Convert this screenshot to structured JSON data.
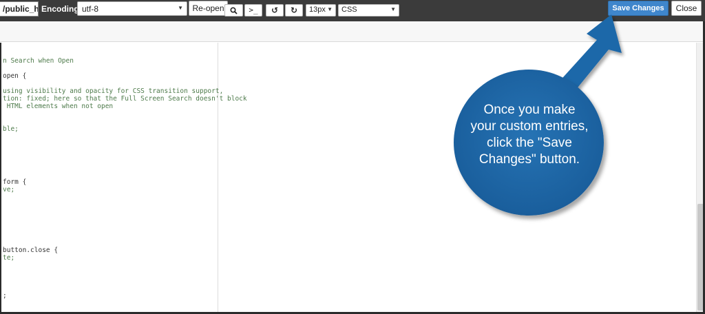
{
  "header": {
    "path_value": "/public_h",
    "encoding_label": "Encoding:",
    "encoding_value": "utf-8",
    "reopen_label": "Re-open",
    "save_label": "Save Changes",
    "close_label": "Close"
  },
  "toolbar": {
    "search_glyph": "🔍",
    "console_glyph": ">_",
    "undo_glyph": "↺",
    "redo_glyph": "↻",
    "font_size": "13px",
    "language": "CSS"
  },
  "code_lines": [
    "n Search when Open",
    "open {",
    "using visibility and opacity for CSS transition support,",
    "tion: fixed; here so that the Full Screen Search doesn't block",
    " HTML elements when not open",
    "ble;",
    "form {",
    "ve;",
    "button.close {",
    "te;",
    ";"
  ],
  "callout": {
    "text_lines": [
      "Once you make",
      "your custom entries,",
      "click the \"Save",
      "Changes\" button."
    ]
  },
  "colors": {
    "save_button": "#3f86cc",
    "callout": "#1a5f9d",
    "topbar": "#3b3b3b"
  }
}
